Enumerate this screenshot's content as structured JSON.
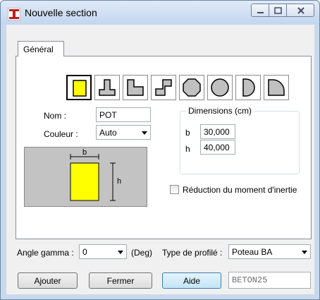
{
  "window": {
    "title": "Nouvelle section",
    "icon": "i-beam-red-icon",
    "controls": [
      "minimize-icon",
      "maximize-icon",
      "close-icon"
    ]
  },
  "tabs": [
    {
      "label": "Général",
      "selected": true
    }
  ],
  "shape_buttons": [
    {
      "name": "rectangle",
      "selected": true,
      "fill": "#ffff00"
    },
    {
      "name": "t-section",
      "selected": false
    },
    {
      "name": "l-section",
      "selected": false
    },
    {
      "name": "z-section",
      "selected": false
    },
    {
      "name": "octagon",
      "selected": false
    },
    {
      "name": "circle",
      "selected": false
    },
    {
      "name": "half-circle",
      "selected": false
    },
    {
      "name": "quarter-circle",
      "selected": false
    }
  ],
  "form": {
    "nom_label": "Nom :",
    "nom_value": "POT",
    "couleur_label": "Couleur :",
    "couleur_value": "Auto"
  },
  "dimensions": {
    "legend": "Dimensions (cm)",
    "b_label": "b",
    "b_value": "30,000",
    "h_label": "h",
    "h_value": "40,000"
  },
  "preview": {
    "b_label": "b",
    "h_label": "h",
    "fill": "#ffff00",
    "background": "#c3c3c3"
  },
  "reduction": {
    "label": "Réduction du moment d'inertie",
    "checked": false
  },
  "angle": {
    "label": "Angle gamma :",
    "value": "0",
    "unit": "(Deg)"
  },
  "profile": {
    "label": "Type de profilé :",
    "value": "Poteau BA"
  },
  "buttons": {
    "ajouter": "Ajouter",
    "fermer": "Fermer",
    "aide": "Aide"
  },
  "material": "BETON25"
}
